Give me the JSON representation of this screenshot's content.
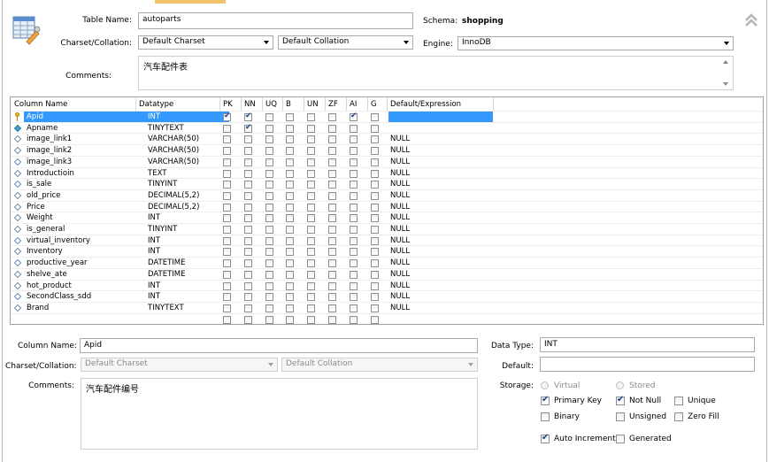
{
  "table": {
    "name_label": "Table Name:",
    "name_value": "autoparts",
    "schema_label": "Schema:",
    "schema_value": "shopping",
    "charset_label": "Charset/Collation:",
    "charset_value": "Default Charset",
    "collation_value": "Default Collation",
    "engine_label": "Engine:",
    "engine_value": "InnoDB",
    "comments_label": "Comments:",
    "comments_value": "汽车配件表"
  },
  "grid": {
    "headers": [
      "Column Name",
      "Datatype",
      "PK",
      "NN",
      "UQ",
      "B",
      "UN",
      "ZF",
      "AI",
      "G",
      "Default/Expression"
    ],
    "rows": [
      {
        "name": "Apid",
        "type": "INT",
        "default": "",
        "pk": true,
        "nn": true,
        "ai": true,
        "selected": true,
        "icon": "primary-key-icon"
      },
      {
        "name": "Apname",
        "type": "TINYTEXT",
        "default": "",
        "pk": false,
        "nn": true,
        "ai": false,
        "icon": "column-not-null-icon"
      },
      {
        "name": "image_link1",
        "type": "VARCHAR(50)",
        "default": "NULL",
        "icon": "column-icon"
      },
      {
        "name": "image_link2",
        "type": "VARCHAR(50)",
        "default": "NULL",
        "icon": "column-icon"
      },
      {
        "name": "image_link3",
        "type": "VARCHAR(50)",
        "default": "NULL",
        "icon": "column-icon"
      },
      {
        "name": "Introductioin",
        "type": "TEXT",
        "default": "NULL",
        "icon": "column-icon"
      },
      {
        "name": "is_sale",
        "type": "TINYINT",
        "default": "NULL",
        "icon": "column-icon"
      },
      {
        "name": "old_price",
        "type": "DECIMAL(5,2)",
        "default": "NULL",
        "icon": "column-icon"
      },
      {
        "name": "Price",
        "type": "DECIMAL(5,2)",
        "default": "NULL",
        "icon": "column-icon"
      },
      {
        "name": "Weight",
        "type": "INT",
        "default": "NULL",
        "icon": "column-icon"
      },
      {
        "name": "is_general",
        "type": "TINYINT",
        "default": "NULL",
        "icon": "column-icon"
      },
      {
        "name": "virtual_inventory",
        "type": "INT",
        "default": "NULL",
        "icon": "column-icon"
      },
      {
        "name": "Inventory",
        "type": "INT",
        "default": "NULL",
        "icon": "column-icon"
      },
      {
        "name": "productive_year",
        "type": "DATETIME",
        "default": "NULL",
        "icon": "column-icon"
      },
      {
        "name": "shelve_ate",
        "type": "DATETIME",
        "default": "NULL",
        "icon": "column-icon"
      },
      {
        "name": "hot_product",
        "type": "INT",
        "default": "NULL",
        "icon": "column-icon"
      },
      {
        "name": "SecondClass_sdd",
        "type": "INT",
        "default": "NULL",
        "icon": "column-icon"
      },
      {
        "name": "Brand",
        "type": "TINYTEXT",
        "default": "NULL",
        "icon": "column-icon"
      },
      {
        "name": "",
        "type": "",
        "default": "",
        "icon": ""
      }
    ]
  },
  "detail": {
    "column_name_label": "Column Name:",
    "column_name_value": "Apid",
    "charset_label": "Charset/Collation:",
    "charset_value": "Default Charset",
    "collation_value": "Default Collation",
    "comments_label": "Comments:",
    "comments_value": "汽车配件编号",
    "datatype_label": "Data Type:",
    "datatype_value": "INT",
    "default_label": "Default:",
    "default_value": "",
    "storage_label": "Storage:",
    "virtual_label": "Virtual",
    "stored_label": "Stored",
    "primary_key_label": "Primary Key",
    "not_null_label": "Not Null",
    "unique_label": "Unique",
    "binary_label": "Binary",
    "unsigned_label": "Unsigned",
    "zero_fill_label": "Zero Fill",
    "auto_increment_label": "Auto Increment",
    "generated_label": "Generated",
    "primary_key_checked": true,
    "not_null_checked": true,
    "auto_increment_checked": true
  },
  "colors": {
    "selection": "#3399ff",
    "tab_accent": "#f2c36b"
  }
}
